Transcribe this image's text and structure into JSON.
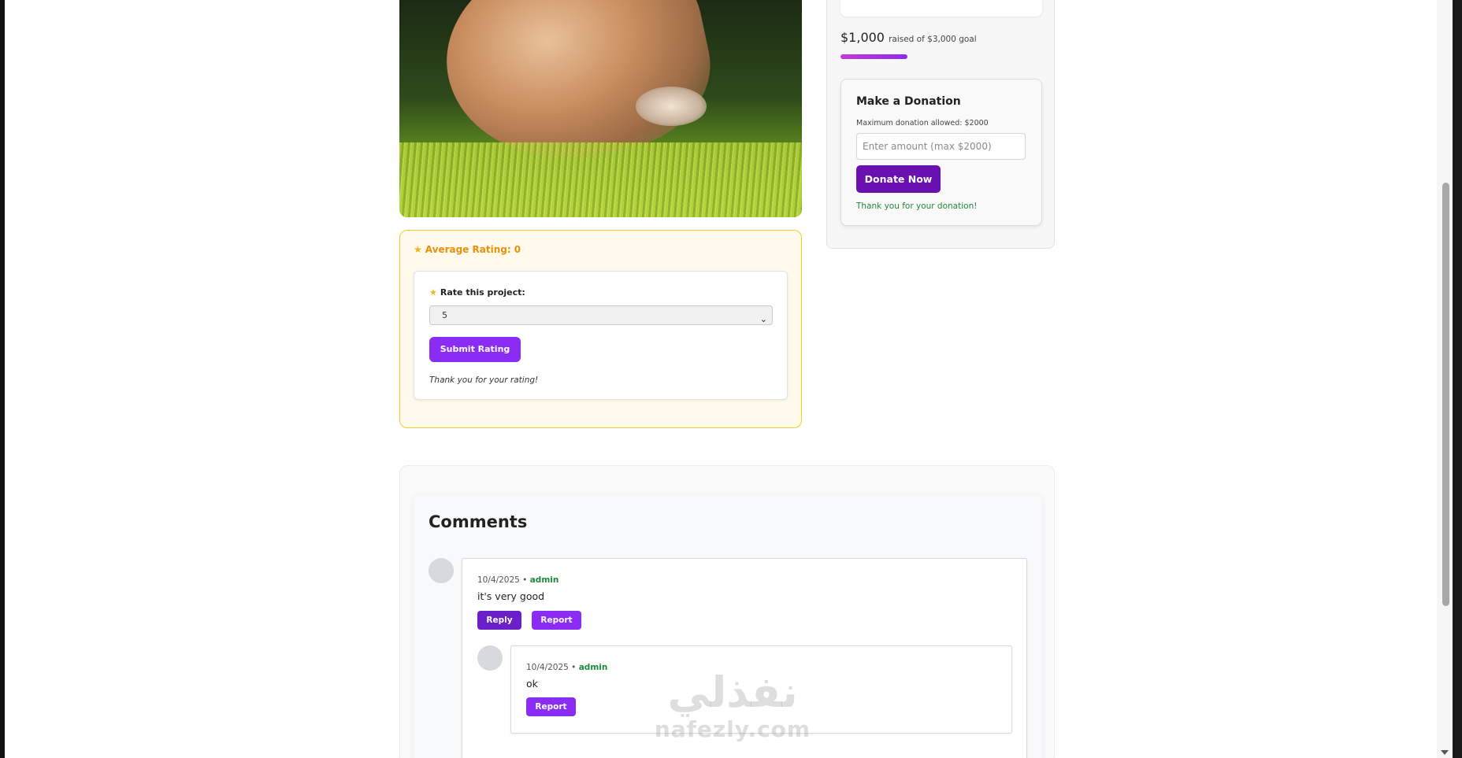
{
  "rating": {
    "average_label": "Average Rating: 0",
    "rate_label": "Rate this project:",
    "selected_value": "5",
    "submit_label": "Submit Rating",
    "thanks": "Thank you for your rating!"
  },
  "donation": {
    "raised_amount": "$1,000",
    "raised_text": "raised of $3,000 goal",
    "progress_fraction": 0.333,
    "title": "Make a Donation",
    "max_text": "Maximum donation allowed: $2000",
    "input_placeholder": "Enter amount (max $2000)",
    "donate_label": "Donate Now",
    "thanks": "Thank you for your donation!"
  },
  "comments": {
    "title": "Comments",
    "items": [
      {
        "date": "10/4/2025",
        "separator": " • ",
        "author": "admin",
        "text": "it's very good",
        "reply_label": "Reply",
        "report_label": "Report",
        "replies": [
          {
            "date": "10/4/2025",
            "separator": " • ",
            "author": "admin",
            "text": "ok",
            "report_label": "Report"
          }
        ]
      }
    ]
  },
  "watermark": {
    "arabic": "نفذلي",
    "latin": "nafezly.com"
  },
  "icons": {
    "star": "star-icon",
    "select_chevron": "chevron-down-icon"
  },
  "colors": {
    "accent_purple": "#8b2cf5",
    "dark_purple": "#6a0fb0",
    "rating_orange": "#e8900c",
    "success_green": "#1e8a3a"
  }
}
